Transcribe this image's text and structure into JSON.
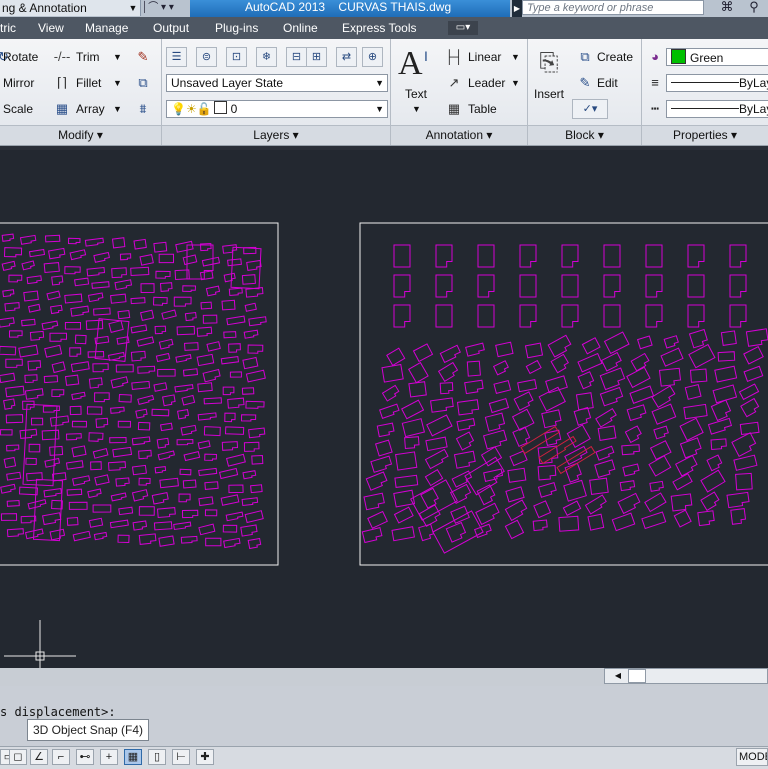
{
  "titlebar": {
    "workspace": "ng & Annotation",
    "app_title": "AutoCAD 2013",
    "file_name": "CURVAS THAIS.dwg",
    "search_placeholder": "Type a keyword or phrase"
  },
  "menu_tabs": [
    "tric",
    "View",
    "Manage",
    "Output",
    "Plug-ins",
    "Online",
    "Express Tools"
  ],
  "ribbon": {
    "modify": {
      "title": "Modify",
      "items": [
        "Rotate",
        "Mirror",
        "Scale",
        "Trim",
        "Fillet",
        "Array"
      ]
    },
    "layers": {
      "title": "Layers",
      "layer_state": "Unsaved Layer State",
      "current_layer": "0"
    },
    "annotation": {
      "title": "Annotation",
      "text_label": "Text",
      "items": [
        "Linear",
        "Leader",
        "Table"
      ]
    },
    "block": {
      "title": "Block",
      "insert_label": "Insert",
      "items": [
        "Create",
        "Edit"
      ]
    },
    "properties": {
      "title": "Properties",
      "color": "Green",
      "linetype": "ByLay",
      "lineweight": "ByLay",
      "color_hex": "#00c000"
    }
  },
  "command_line": {
    "text": "s displacement>:",
    "tooltip": "3D Object Snap (F4)"
  },
  "status_bar": {
    "model_label": "MODE"
  },
  "colors": {
    "geometry": "#d400d4",
    "highlight": "#d02040",
    "viewport_frame": "#f0f0f0",
    "canvas_bg": "#232830"
  }
}
